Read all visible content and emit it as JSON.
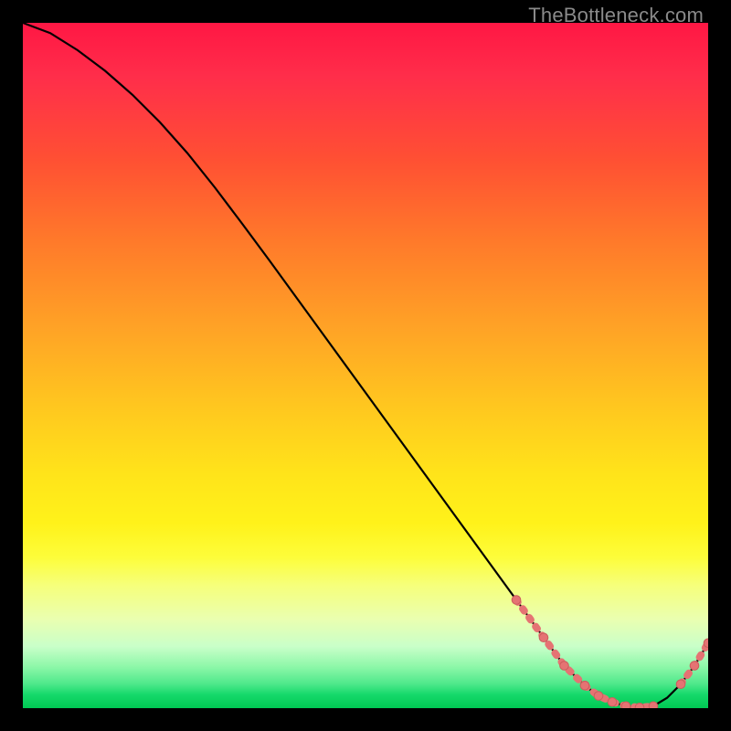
{
  "watermark": "TheBottleneck.com",
  "colors": {
    "background": "#000000",
    "gradient_top": "#ff1744",
    "gradient_bottom": "#00c853",
    "curve": "#000000",
    "marker": "#e57373",
    "marker_stroke": "#cc5d5d"
  },
  "chart_data": {
    "type": "line",
    "title": "",
    "xlabel": "",
    "ylabel": "",
    "xlim": [
      0,
      100
    ],
    "ylim": [
      0,
      100
    ],
    "x": [
      0,
      4,
      8,
      12,
      16,
      20,
      24,
      28,
      32,
      36,
      40,
      44,
      48,
      52,
      56,
      60,
      64,
      68,
      72,
      76,
      79,
      82,
      84,
      86,
      88,
      90,
      92,
      94,
      96,
      98,
      100
    ],
    "values": [
      100,
      98.5,
      96,
      93,
      89.5,
      85.5,
      81,
      76,
      70.7,
      65.3,
      59.8,
      54.3,
      48.8,
      43.3,
      37.8,
      32.3,
      26.8,
      21.3,
      15.8,
      10.3,
      6.2,
      3.3,
      1.8,
      0.9,
      0.3,
      0.1,
      0.3,
      1.5,
      3.5,
      6.2,
      9.5
    ],
    "annotations": {
      "highlighted_segments": [
        {
          "x": [
            72,
            76,
            79,
            82
          ],
          "y": [
            15.8,
            10.3,
            6.2,
            3.3
          ],
          "note": "descending pink dotted run"
        },
        {
          "x": [
            82,
            84,
            86,
            88,
            90,
            92
          ],
          "y": [
            3.3,
            1.8,
            0.9,
            0.3,
            0.1,
            0.3
          ],
          "note": "valley pink dotted run"
        },
        {
          "x": [
            96,
            98,
            100
          ],
          "y": [
            3.5,
            6.2,
            9.5
          ],
          "note": "ascending pink dotted run"
        }
      ]
    }
  }
}
